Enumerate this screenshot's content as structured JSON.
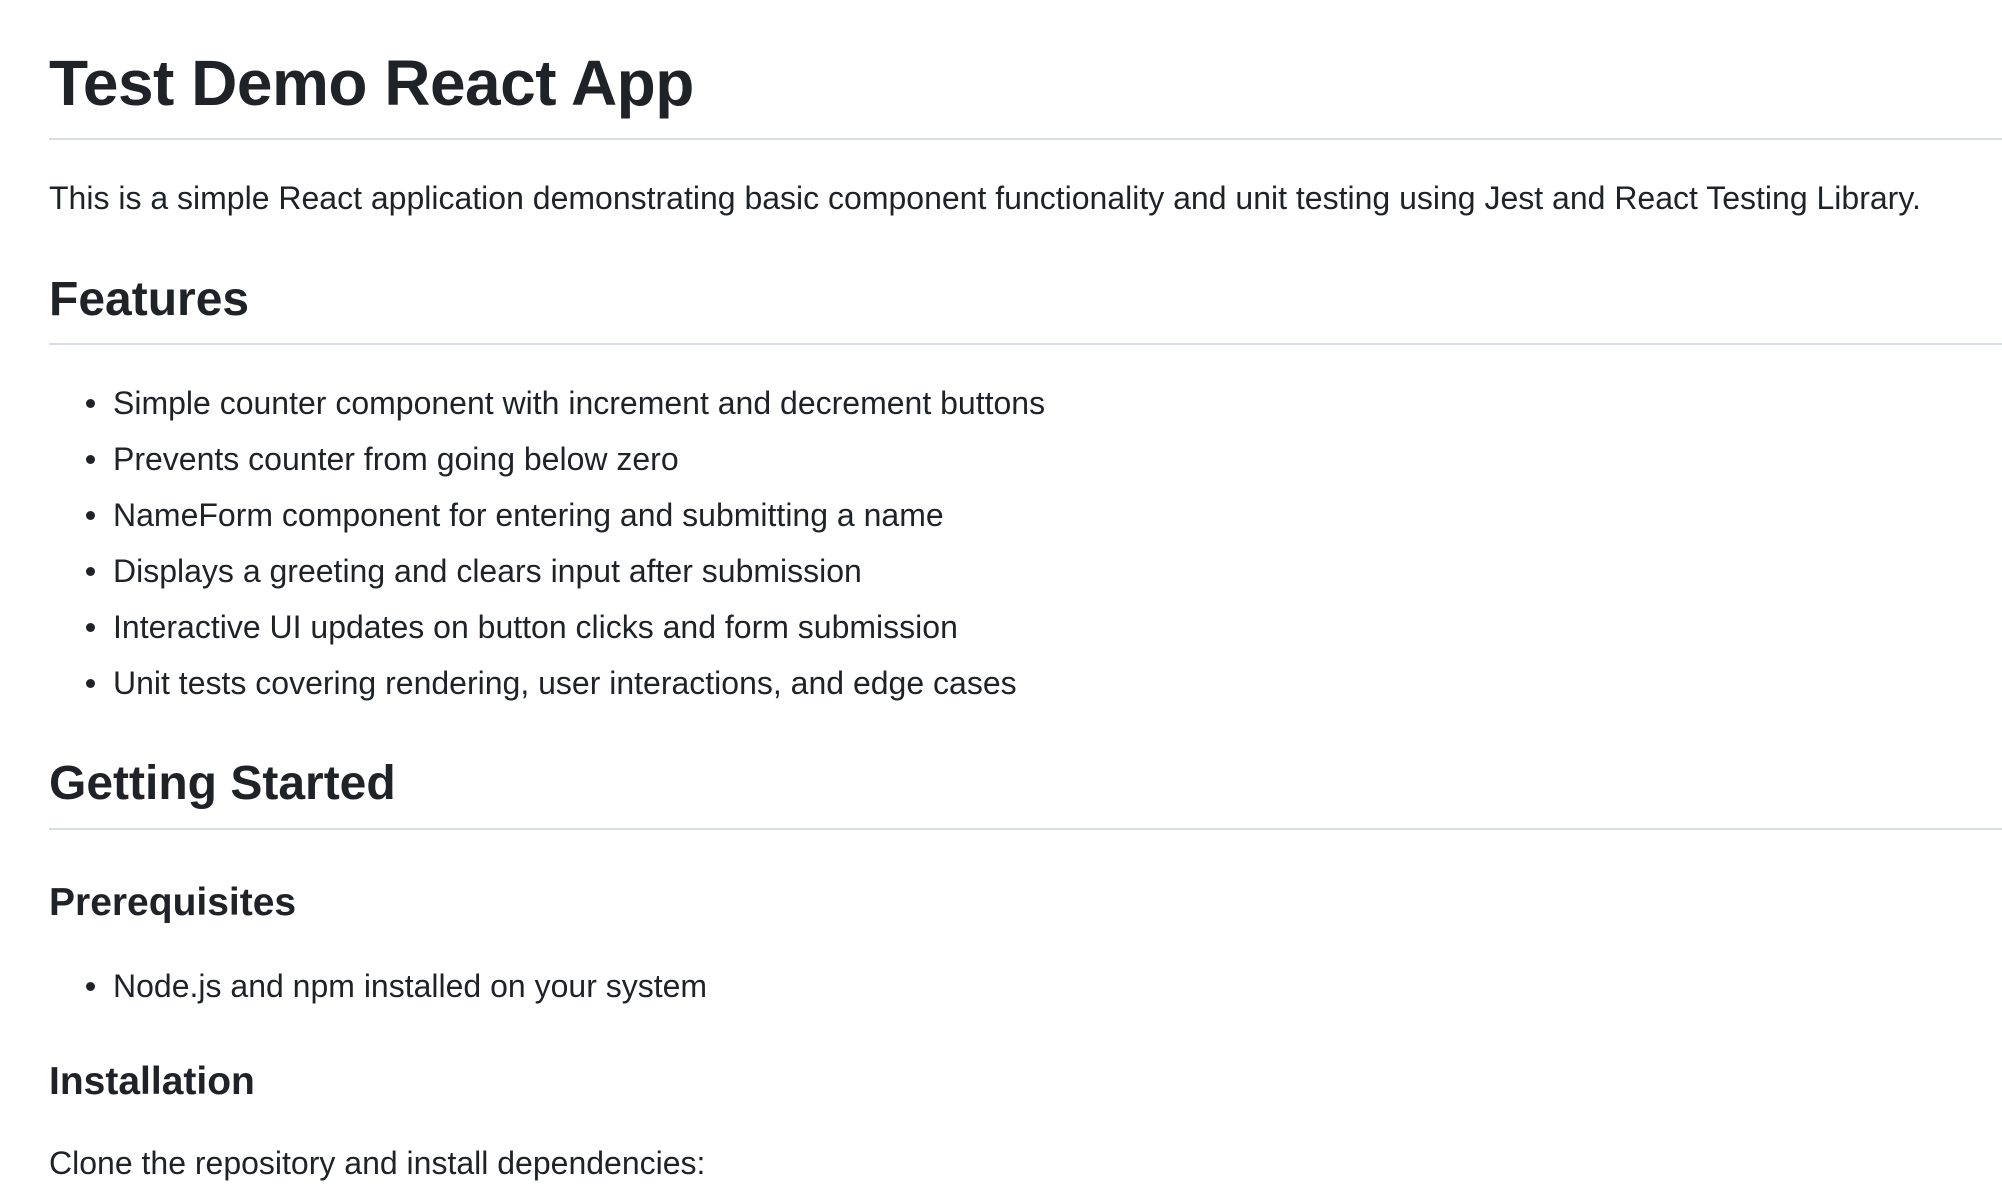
{
  "title": "Test Demo React App",
  "intro": "This is a simple React application demonstrating basic component functionality and unit testing using Jest and React Testing Library.",
  "sections": {
    "features": {
      "heading": "Features",
      "items": [
        "Simple counter component with increment and decrement buttons",
        "Prevents counter from going below zero",
        "NameForm component for entering and submitting a name",
        "Displays a greeting and clears input after submission",
        "Interactive UI updates on button clicks and form submission",
        "Unit tests covering rendering, user interactions, and edge cases"
      ]
    },
    "getting_started": {
      "heading": "Getting Started",
      "prerequisites": {
        "heading": "Prerequisites",
        "items": [
          "Node.js and npm installed on your system"
        ]
      },
      "installation": {
        "heading": "Installation",
        "text": "Clone the repository and install dependencies:"
      }
    }
  }
}
